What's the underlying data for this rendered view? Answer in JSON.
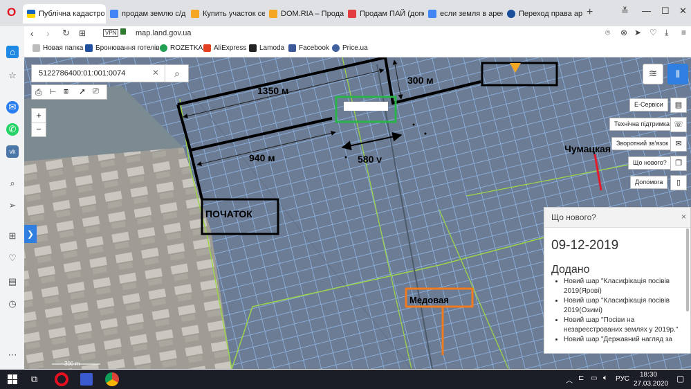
{
  "browser": {
    "logo": "O",
    "tabs": [
      {
        "label": "Публічна кадастро",
        "active": true,
        "favicon_color": "#ffd700"
      },
      {
        "label": "продам землю с/д",
        "active": false,
        "favicon_color": "#4285f4"
      },
      {
        "label": "Купить участок сел",
        "active": false,
        "favicon_color": "#f5a623"
      },
      {
        "label": "DOM.RIA – Продаж",
        "active": false,
        "favicon_color": "#f5a623"
      },
      {
        "label": "Продам ПАЙ (допо",
        "active": false,
        "favicon_color": "#e23e3e"
      },
      {
        "label": "если земля в арен",
        "active": false,
        "favicon_color": "#4285f4"
      },
      {
        "label": "Переход права арен",
        "active": false,
        "favicon_color": "#1a4f9c"
      }
    ],
    "new_tab": "+",
    "vpn": "VPN",
    "url": "map.land.gov.ua",
    "bookmarks": [
      {
        "label": "Новая папка",
        "color": "#999999"
      },
      {
        "label": "Бронювання готелів",
        "color": "#2050a0"
      },
      {
        "label": "ROZETKA",
        "color": "#20a050"
      },
      {
        "label": "AliExpress",
        "color": "#e24020"
      },
      {
        "label": "Lamoda",
        "color": "#222222"
      },
      {
        "label": "Facebook",
        "color": "#3b5998"
      },
      {
        "label": "Price.ua",
        "color": "#4060a0"
      }
    ]
  },
  "map": {
    "search_value": "5122786400:01:001:0074",
    "zoom_in": "+",
    "zoom_out": "−",
    "scale_label": "300 m",
    "menu": [
      "Е-Сервіси",
      "Технічна підтримка",
      "Зворотний зв'язок",
      "Що нового?",
      "Допомога"
    ],
    "annotations": {
      "d1350": "1350 м",
      "d300": "300 м",
      "d940": "940 м",
      "d580": "580 v",
      "start": "ПОЧАТОК",
      "chumatskaya": "Чумацкая",
      "medovaya": "Медовая"
    },
    "news_panel": {
      "title": "Що нового?",
      "close": "×",
      "date": "09-12-2019",
      "heading": "Додано",
      "items": [
        "Новий шар \"Класифікація посівів 2019(Ярові)",
        "Новий шар \"Класифікація посівів 2019(Озимі)",
        "Новий шар \"Посіви на незареєстрованих землях у 2019р.\"",
        "Новий шар \"Державний нагляд за"
      ]
    }
  },
  "taskbar": {
    "time": "18:30",
    "date": "27.03.2020",
    "lang": "РУС"
  }
}
